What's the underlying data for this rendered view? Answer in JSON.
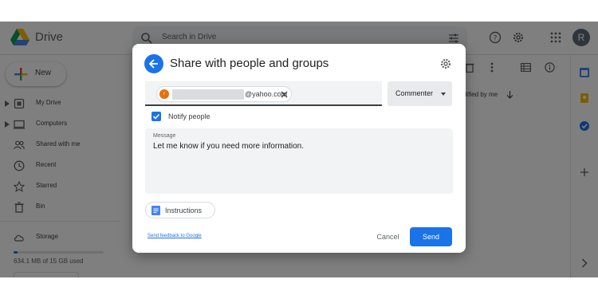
{
  "app": {
    "name": "Drive",
    "search_placeholder": "Search in Drive",
    "avatar_initial": "R"
  },
  "sidebar": {
    "new_label": "New",
    "items": [
      {
        "label": "My Drive",
        "icon": "drive-folder-icon"
      },
      {
        "label": "Computers",
        "icon": "computer-icon"
      },
      {
        "label": "Shared with me",
        "icon": "people-icon"
      },
      {
        "label": "Recent",
        "icon": "clock-icon"
      },
      {
        "label": "Starred",
        "icon": "star-icon"
      },
      {
        "label": "Bin",
        "icon": "trash-icon"
      }
    ],
    "storage_label": "Storage",
    "storage_used": "634.1 MB of 15 GB used",
    "storage_fraction": 0.04
  },
  "main": {
    "sort_label": "dified by me"
  },
  "dialog": {
    "title": "Share with people and groups",
    "recipient": {
      "avatar_initial": "r",
      "email_suffix": "@yahoo.com"
    },
    "role": "Commenter",
    "notify_label": "Notify people",
    "notify_checked": true,
    "message_label": "Message",
    "message_text": "Let me know if you need more information.",
    "instructions_label": "Instructions",
    "feedback_link": "Send feedback to Google",
    "cancel_label": "Cancel",
    "send_label": "Send"
  },
  "colors": {
    "accent": "#1a73e8",
    "avatar_chip": "#e8710a",
    "dialog_bg": "#ffffff",
    "field_bg": "#f1f3f4"
  }
}
